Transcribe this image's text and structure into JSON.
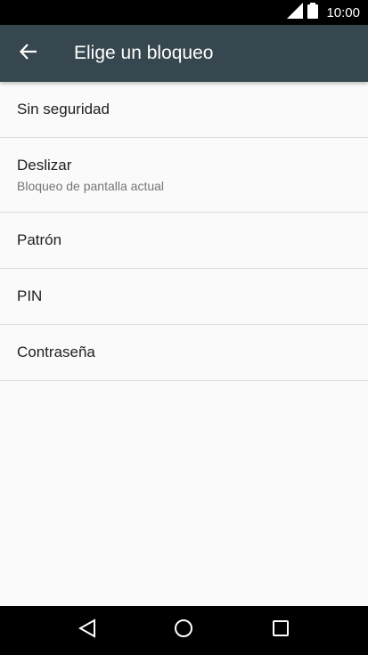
{
  "status_bar": {
    "time": "10:00",
    "icons": [
      "signal-icon",
      "battery-icon"
    ]
  },
  "app_bar": {
    "title": "Elige un bloqueo",
    "back_icon": "arrow-back-icon"
  },
  "lock_options": [
    {
      "title": "Sin seguridad"
    },
    {
      "title": "Deslizar",
      "subtitle": "Bloqueo de pantalla actual"
    },
    {
      "title": "Patrón"
    },
    {
      "title": "PIN"
    },
    {
      "title": "Contraseña"
    }
  ],
  "nav_bar": {
    "buttons": [
      "back-triangle-icon",
      "home-circle-icon",
      "recents-square-icon"
    ]
  },
  "colors": {
    "status_bar": "#000000",
    "app_bar": "#37474f",
    "background": "#fafafa",
    "divider": "#dddddd",
    "primary_text": "#212121",
    "secondary_text": "#757575",
    "nav_bar": "#000000"
  }
}
